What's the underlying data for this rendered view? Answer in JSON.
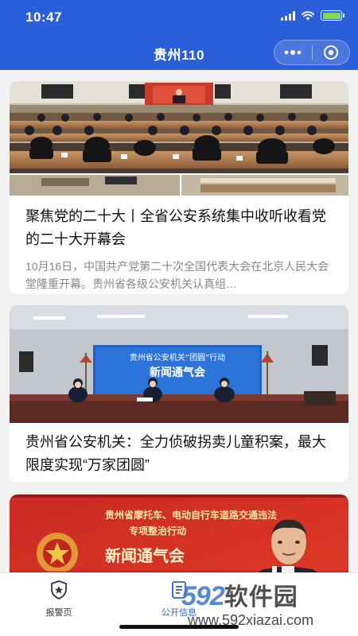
{
  "status_bar": {
    "time": "10:47"
  },
  "header": {
    "title": "贵州110"
  },
  "articles": [
    {
      "title": "聚焦党的二十大丨全省公安系统集中收听收看党的二十大开幕会",
      "summary": "10月16日，中国共产党第二十次全国代表大会在北京人民大会堂隆重开幕。贵州省各级公安机关认真组…"
    },
    {
      "title": "贵州省公安机关：全力侦破拐卖儿童积案，最大限度实现“万家团圆”",
      "summary": "",
      "banner_line1": "贵州省公安机关“团圆”行动",
      "banner_line2": "新闻通气会"
    },
    {
      "title": "",
      "banner_line1": "贵州省摩托车、电动自行车道路交通违法",
      "banner_line2": "专项整治行动",
      "banner_line3": "新闻通气会"
    }
  ],
  "tabbar": {
    "items": [
      {
        "label": "报警页",
        "icon": "police-badge-icon"
      },
      {
        "label": "公开信息",
        "icon": "document-icon"
      }
    ]
  },
  "watermark": {
    "brand_digits": "592",
    "brand_text": "软件园",
    "url": "www.592xiazai.com"
  },
  "colors": {
    "primary": "#2b5fd9",
    "card_bg": "#ffffff",
    "page_bg": "#f2f2f2"
  }
}
